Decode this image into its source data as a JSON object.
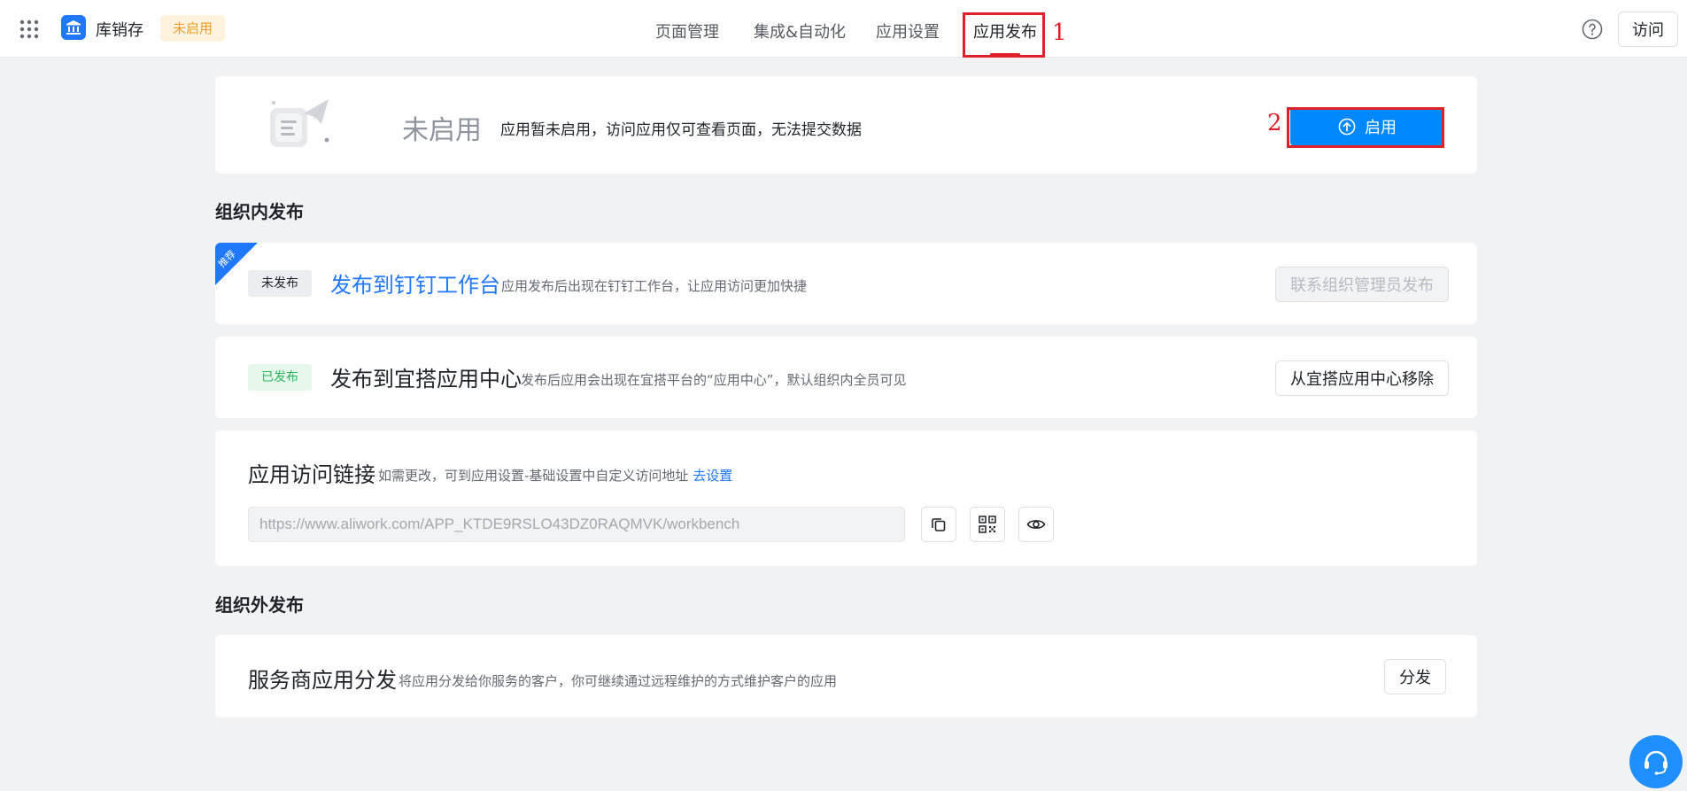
{
  "header": {
    "app_name": "库销存",
    "status_pill": "未启用",
    "tabs": [
      {
        "label": "页面管理"
      },
      {
        "label": "集成&自动化"
      },
      {
        "label": "应用设置"
      },
      {
        "label": "应用发布"
      }
    ],
    "visit_label": "访问"
  },
  "annotations": {
    "one": "1",
    "two": "2"
  },
  "status_card": {
    "status_big": "未启用",
    "description": "应用暂未启用，访问应用仅可查看页面，无法提交数据",
    "enable_label": "启用"
  },
  "internal": {
    "section_title": "组织内发布",
    "dingtalk": {
      "ribbon": "推荐",
      "badge": "未发布",
      "title": "发布到钉钉工作台",
      "description": "应用发布后出现在钉钉工作台，让应用访问更加快捷",
      "button": "联系组织管理员发布"
    },
    "yida": {
      "badge": "已发布",
      "title": "发布到宜搭应用中心",
      "description": "发布后应用会出现在宜搭平台的“应用中心”，默认组织内全员可见",
      "button": "从宜搭应用中心移除"
    },
    "access_link": {
      "title": "应用访问链接",
      "description": "如需更改，可到应用设置-基础设置中自定义访问地址",
      "action": "去设置",
      "url": "https://www.aliwork.com/APP_KTDE9RSLO43DZ0RAQMVK/workbench"
    }
  },
  "external": {
    "section_title": "组织外发布",
    "vendor": {
      "title": "服务商应用分发",
      "description": "将应用分发给你服务的客户，你可继续通过远程维护的方式维护客户的应用",
      "button": "分发"
    }
  },
  "colors": {
    "accent": "#1f78ff",
    "primary_button": "#0089ff",
    "annotation": "#e0212a",
    "published": "#2db55d",
    "pending": "#f0a020"
  },
  "icons": [
    "apps-grid-icon",
    "app-logo-icon",
    "help-icon",
    "upload-circle-icon",
    "copy-icon",
    "qrcode-icon",
    "eye-icon",
    "customer-service-icon"
  ]
}
